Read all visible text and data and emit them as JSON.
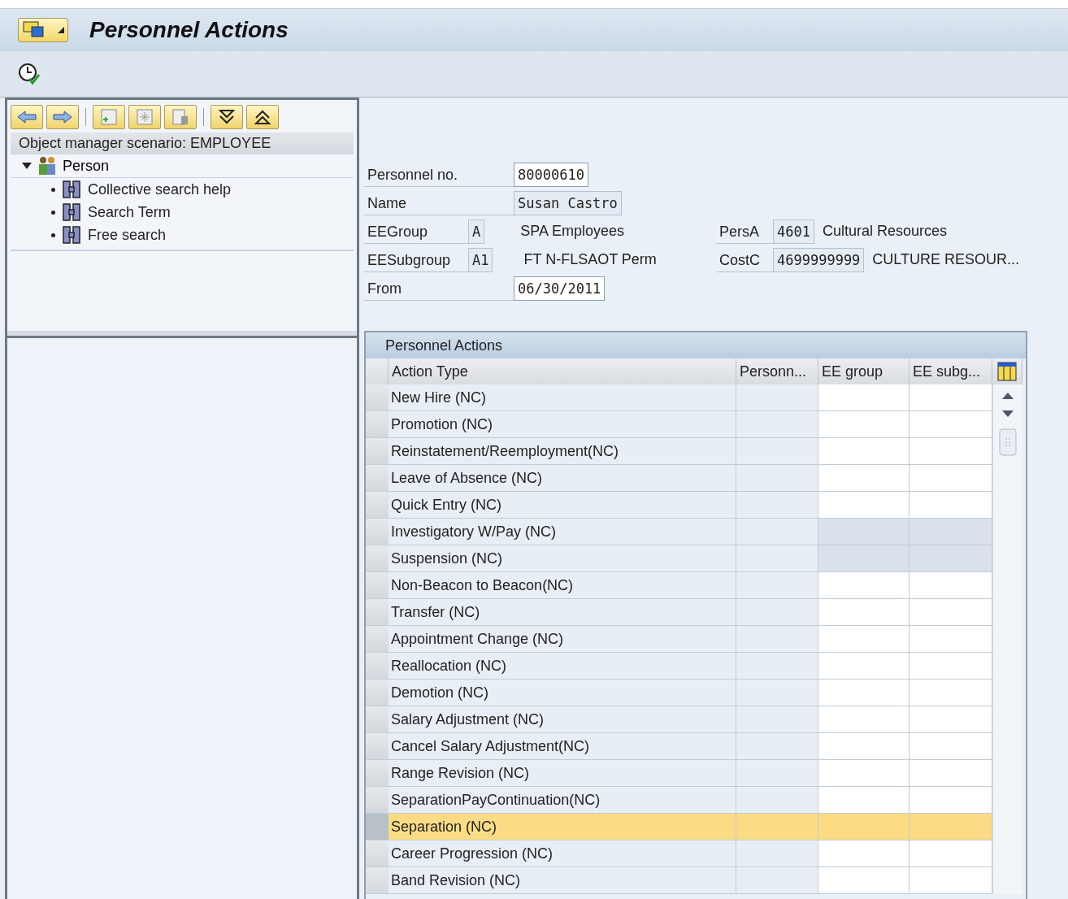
{
  "title": "Personnel Actions",
  "tree": {
    "header": "Object manager scenario: EMPLOYEE",
    "root": {
      "label": "Person",
      "expanded": true,
      "children": [
        {
          "label": "Collective search help"
        },
        {
          "label": "Search Term"
        },
        {
          "label": "Free search"
        }
      ]
    }
  },
  "fields_left": [
    {
      "label": "Personnel no.",
      "value": "80000610",
      "kind": "input"
    },
    {
      "label": "Name",
      "value": "Susan Castro",
      "kind": "display"
    },
    {
      "label": "EEGroup",
      "value": "A",
      "kind": "code",
      "description": "SPA Employees"
    },
    {
      "label": "EESubgroup",
      "value": "A1",
      "kind": "code",
      "description": "FT N-FLSAOT Perm"
    },
    {
      "label": "From",
      "value": "06/30/2011",
      "kind": "input"
    }
  ],
  "fields_right": [
    {
      "label": "PersA",
      "value": "4601",
      "description": "Cultural Resources"
    },
    {
      "label": "CostC",
      "value": "4699999999",
      "description": "CULTURE RESOUR..."
    }
  ],
  "table": {
    "title": "Personnel Actions",
    "columns": [
      "Action Type",
      "Personn...",
      "EE group",
      "EE subg..."
    ],
    "rows": [
      {
        "action_type": "New Hire (NC)",
        "selected": false,
        "editable": true
      },
      {
        "action_type": "Promotion (NC)",
        "selected": false,
        "editable": true
      },
      {
        "action_type": "Reinstatement/Reemployment(NC)",
        "selected": false,
        "editable": true
      },
      {
        "action_type": "Leave of Absence (NC)",
        "selected": false,
        "editable": true
      },
      {
        "action_type": "Quick Entry (NC)",
        "selected": false,
        "editable": true
      },
      {
        "action_type": "Investigatory W/Pay (NC)",
        "selected": false,
        "editable": false
      },
      {
        "action_type": "Suspension (NC)",
        "selected": false,
        "editable": false
      },
      {
        "action_type": "Non-Beacon to Beacon(NC)",
        "selected": false,
        "editable": true
      },
      {
        "action_type": "Transfer (NC)",
        "selected": false,
        "editable": true
      },
      {
        "action_type": "Appointment Change (NC)",
        "selected": false,
        "editable": true
      },
      {
        "action_type": "Reallocation (NC)",
        "selected": false,
        "editable": true
      },
      {
        "action_type": "Demotion (NC)",
        "selected": false,
        "editable": true
      },
      {
        "action_type": "Salary Adjustment (NC)",
        "selected": false,
        "editable": true
      },
      {
        "action_type": "Cancel Salary Adjustment(NC)",
        "selected": false,
        "editable": true
      },
      {
        "action_type": "Range Revision (NC)",
        "selected": false,
        "editable": true
      },
      {
        "action_type": "SeparationPayContinuation(NC)",
        "selected": false,
        "editable": true
      },
      {
        "action_type": "Separation (NC)",
        "selected": true,
        "editable": true
      },
      {
        "action_type": "Career Progression (NC)",
        "selected": false,
        "editable": true
      },
      {
        "action_type": "Band Revision (NC)",
        "selected": false,
        "editable": true
      }
    ]
  }
}
